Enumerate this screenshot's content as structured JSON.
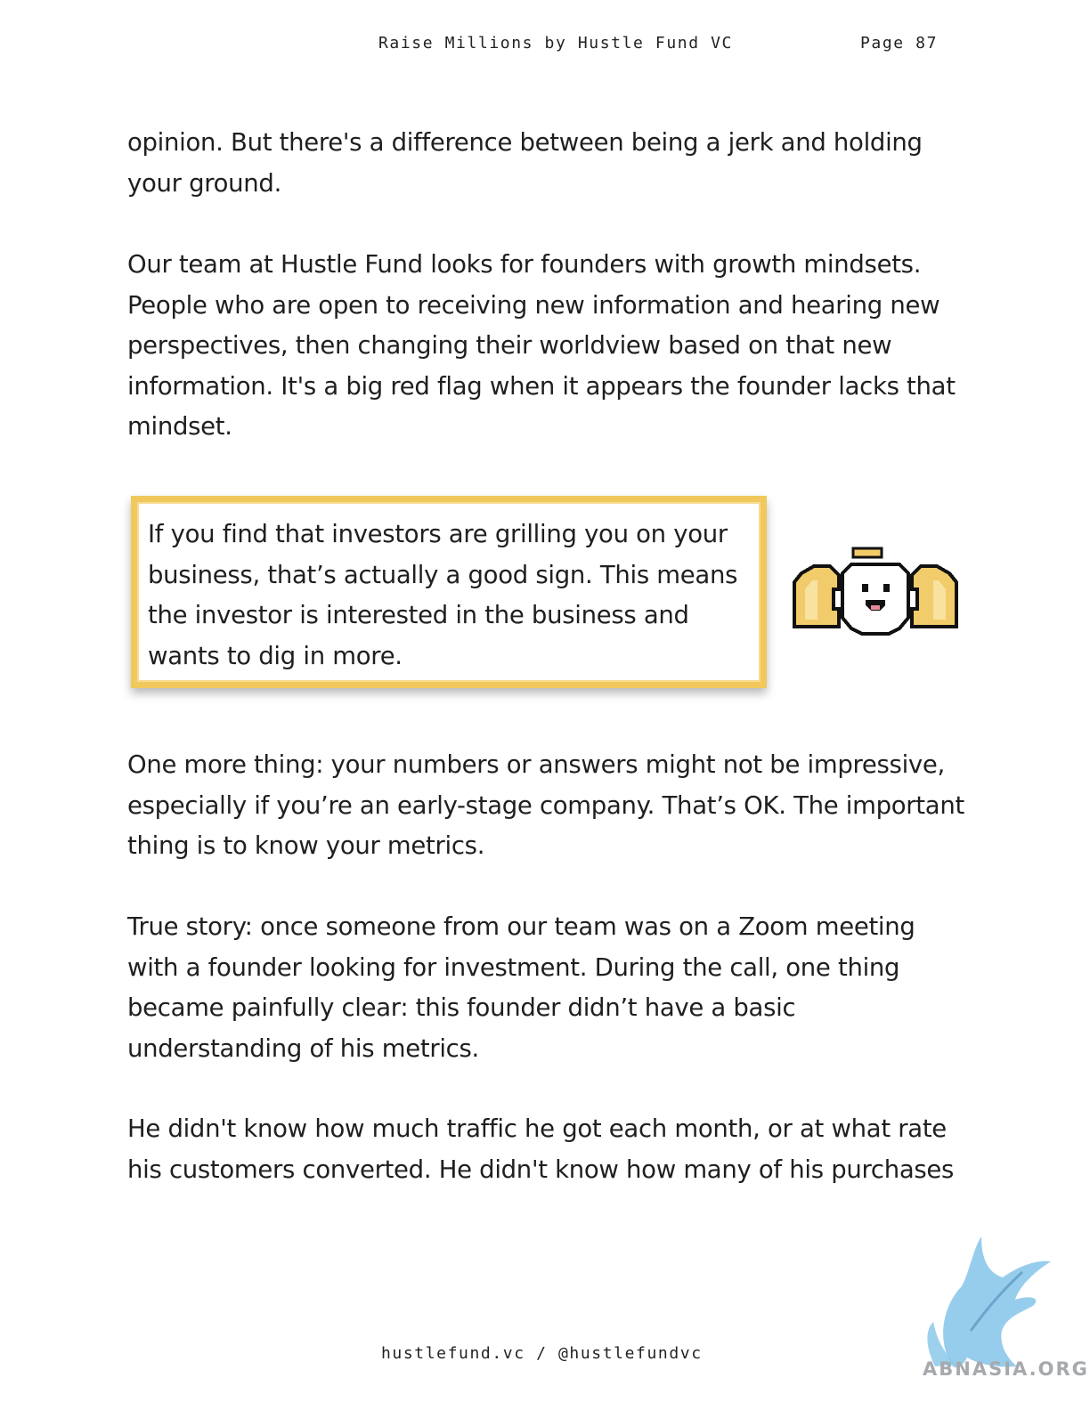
{
  "header": {
    "title": "Raise Millions by Hustle Fund VC",
    "page": "Page 87"
  },
  "body": {
    "p1": "opinion. But there's a difference between being a jerk and holding your ground.",
    "p2": "Our team at Hustle Fund looks for founders with growth mindsets. People who are open to receiving new information and hearing new perspectives, then changing their worldview based on that new information. It's a big red flag when it appears the founder lacks that mindset.",
    "callout": "If you find that investors are grilling you on your business, that’s actually a good sign. This means the investor is interested in the business and wants to dig in more.",
    "p3": "One more thing: your numbers or answers might not be impressive, especially if you’re an early-stage company. That’s OK. The important thing is to know your metrics.",
    "p4": "True story: once someone from our team was on a Zoom meeting with a founder looking for investment. During the call, one thing became painfully clear: this founder didn’t have a basic understanding of his metrics.",
    "p5": "He didn't know how much traffic he got each month, or at what rate his customers converted. He didn't know how many of his purchases"
  },
  "footer": {
    "text": "hustlefund.vc / @hustlefundvc"
  },
  "watermark": {
    "text": "ABNASIA.ORG",
    "icon": "griffin-logo"
  },
  "mascot": {
    "icon": "pixel-angel-mascot"
  },
  "colors": {
    "callout_border": "#f0c85c",
    "wing_fill": "#f2cb6a",
    "watermark_blue": "#8cc8ea"
  }
}
